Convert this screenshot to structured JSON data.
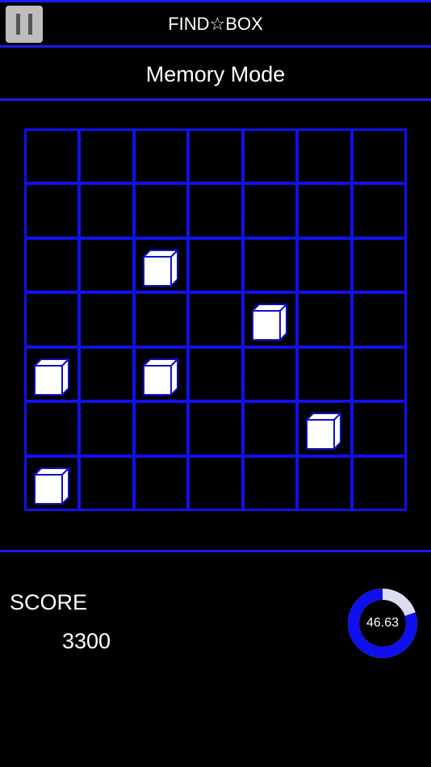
{
  "header": {
    "title": "FIND☆BOX",
    "pause_icon": "pause-icon"
  },
  "mode": {
    "title": "Memory Mode"
  },
  "board": {
    "rows": 7,
    "cols": 7,
    "boxes": [
      {
        "row": 2,
        "col": 2
      },
      {
        "row": 3,
        "col": 4
      },
      {
        "row": 4,
        "col": 0
      },
      {
        "row": 4,
        "col": 2
      },
      {
        "row": 5,
        "col": 5
      },
      {
        "row": 6,
        "col": 0
      }
    ]
  },
  "score": {
    "label": "SCORE",
    "value": "3300"
  },
  "timer": {
    "value": "46.63",
    "remaining_fraction": 0.8
  },
  "colors": {
    "accent": "#1a1aff",
    "grid": "#1010ee",
    "cube_face": "#ffffff",
    "cube_edge": "#1010cc",
    "timer_track": "#dcdcf0"
  }
}
